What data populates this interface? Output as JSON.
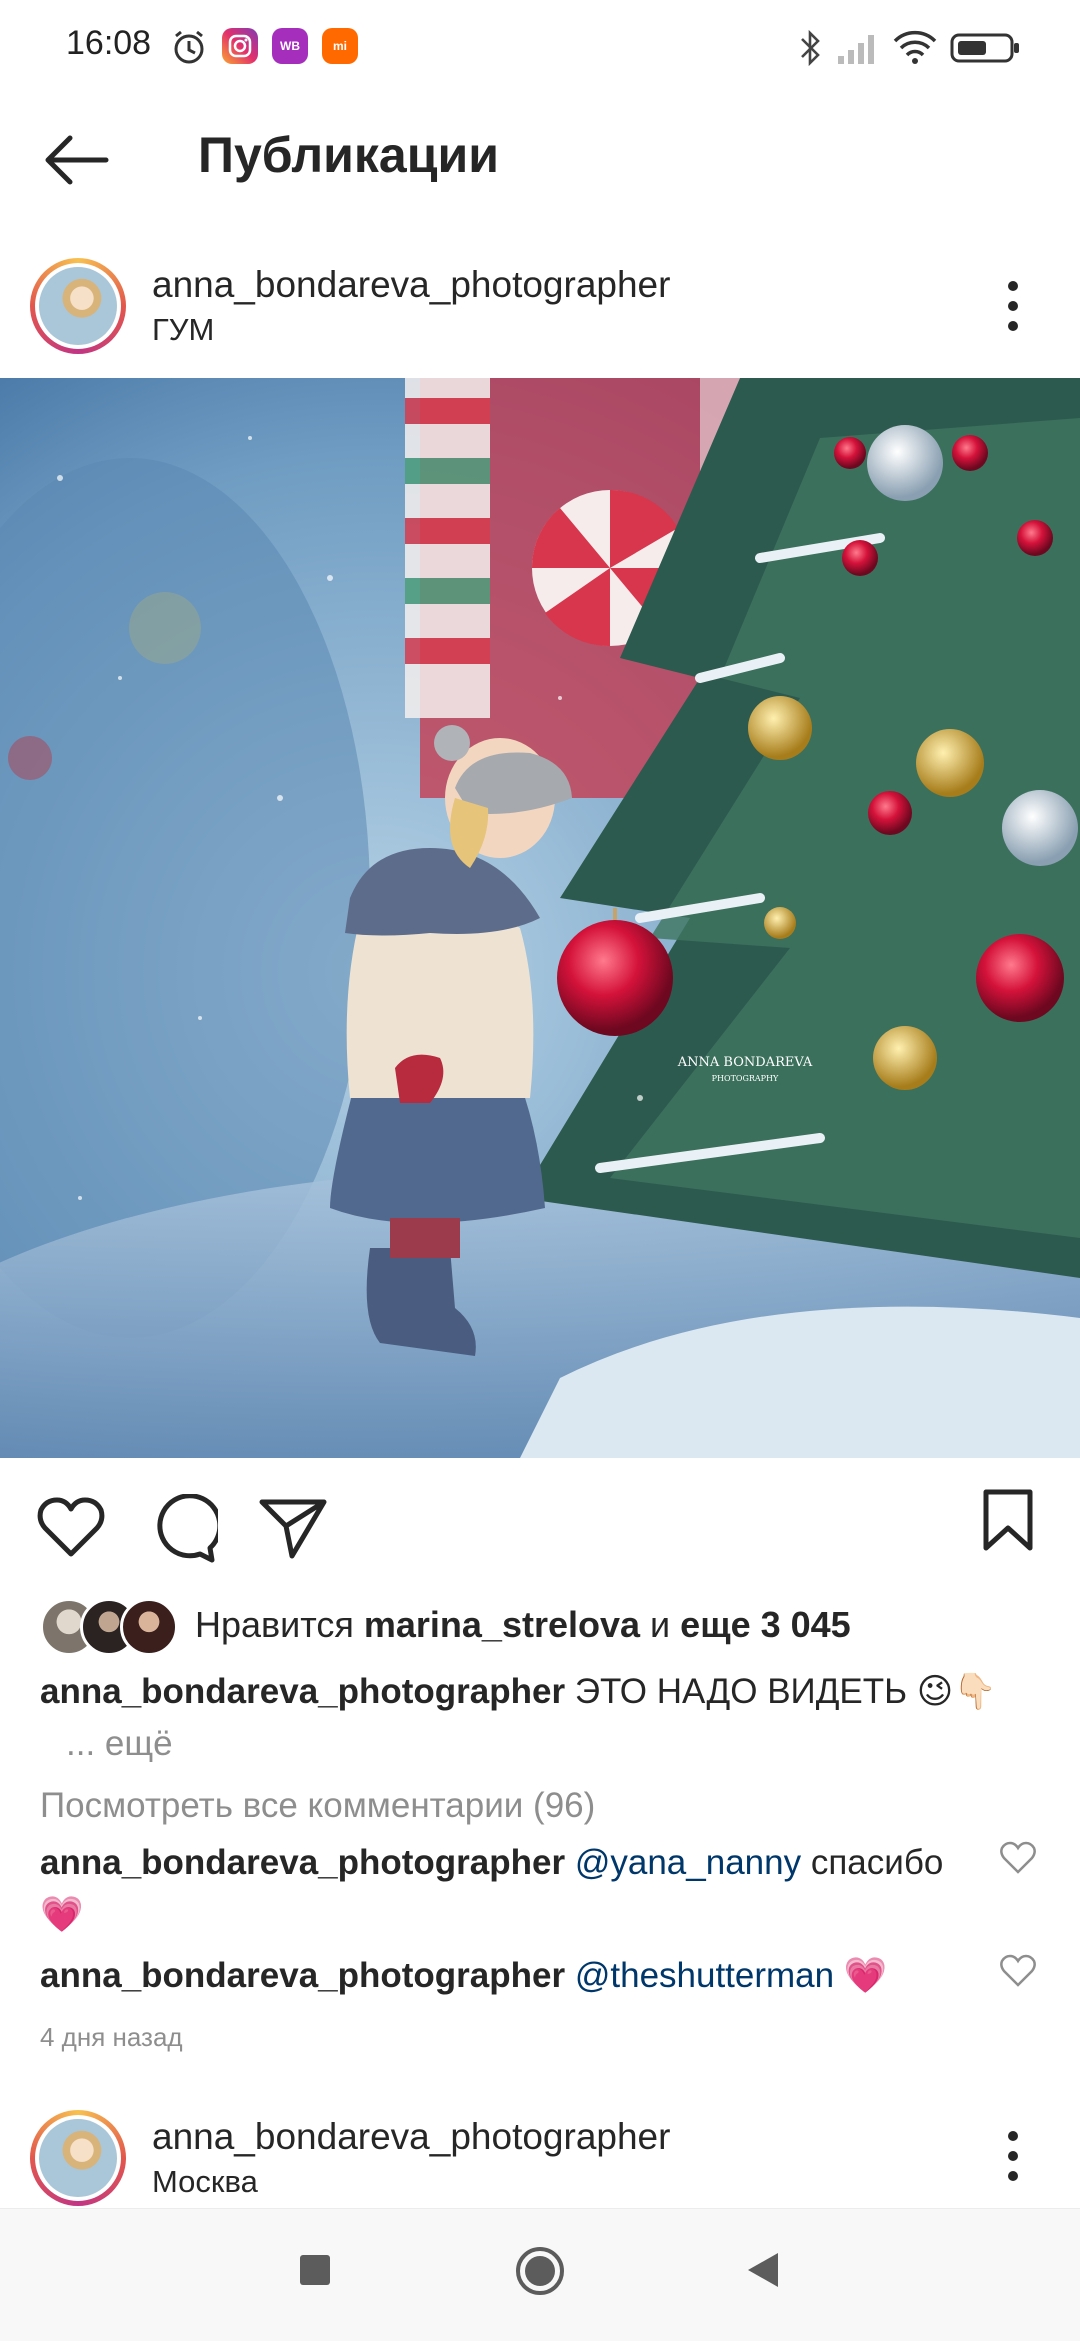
{
  "status_bar": {
    "time": "16:08",
    "app_icons": [
      {
        "name": "alarm-icon"
      },
      {
        "name": "instagram-icon",
        "color": "#d6249f"
      },
      {
        "name": "wildberries-icon",
        "label": "WB",
        "color": "#a52ebd"
      },
      {
        "name": "mi-icon",
        "label": "mi",
        "color": "#ff6900"
      }
    ],
    "right_icons": [
      "bluetooth-icon",
      "signal-icon",
      "wifi-icon",
      "battery-icon"
    ]
  },
  "header": {
    "title": "Публикации"
  },
  "post": {
    "author": "anna_bondareva_photographer",
    "location": "ГУМ",
    "watermark_line1": "ANNA BONDAREVA",
    "watermark_line2": "PHOTOGRAPHY",
    "likes": {
      "prefix": "Нравится",
      "user": "marina_strelova",
      "conj": "и",
      "others": "еще 3 045"
    },
    "caption": {
      "user": "anna_bondareva_photographer",
      "text": "ЭТО НАДО ВИДЕТЬ 😉👇🏻",
      "more": "... ещё"
    },
    "view_all_comments": "Посмотреть все комментарии (96)",
    "comments": [
      {
        "user": "anna_bondareva_photographer",
        "mention": "@yana_nanny",
        "text": "спасибо",
        "emoji": "💗"
      },
      {
        "user": "anna_bondareva_photographer",
        "mention": "@theshutterman",
        "text": "",
        "emoji": "💗"
      }
    ],
    "time_ago": "4 дня назад"
  },
  "next_post": {
    "author": "anna_bondareva_photographer",
    "location": "Москва"
  },
  "colors": {
    "text": "#262626",
    "muted": "#8e8e8e",
    "mention": "#00376b"
  }
}
